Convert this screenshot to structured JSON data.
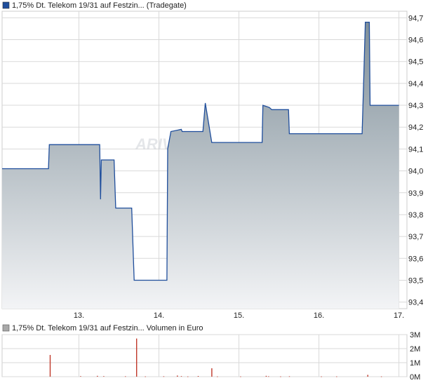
{
  "legend": {
    "price_label": "1,75% Dt. Telekom 19/31 auf Festzin... (Tradegate)",
    "volume_label": "1,75% Dt. Telekom 19/31 auf Festzin... Volumen in Euro"
  },
  "watermark": "ARIVA",
  "colors": {
    "line": "#1f4e9c",
    "fill_top": "#7f8f99",
    "fill_bottom": "#f3f4f6",
    "grid": "#d9d9d9",
    "volume_bar": "#c0392b",
    "legend_swatch_price": "#1f4e9c",
    "legend_swatch_volume": "#a9a9a9"
  },
  "chart_data": [
    {
      "type": "area",
      "xlabel": "",
      "ylabel": "",
      "x_ticks": [
        "13.",
        "14.",
        "15.",
        "16.",
        "17."
      ],
      "x_tick_values": [
        13,
        14,
        15,
        16,
        17
      ],
      "xlim": [
        12.04,
        17.1
      ],
      "ylim": [
        93.37,
        94.73
      ],
      "y_ticks": [
        "93,4",
        "93,5",
        "93,6",
        "93,7",
        "93,8",
        "93,9",
        "94,0",
        "94,1",
        "94,2",
        "94,3",
        "94,4",
        "94,5",
        "94,6",
        "94,7"
      ],
      "y_tick_values": [
        93.4,
        93.5,
        93.6,
        93.7,
        93.8,
        93.9,
        94.0,
        94.1,
        94.2,
        94.3,
        94.4,
        94.5,
        94.6,
        94.7
      ],
      "grid": true,
      "y_axis_position": "right",
      "series": [
        {
          "points": [
            [
              12.04,
              94.01
            ],
            [
              12.62,
              94.01
            ],
            [
              12.63,
              94.12
            ],
            [
              13.26,
              94.12
            ],
            [
              13.27,
              93.87
            ],
            [
              13.28,
              94.05
            ],
            [
              13.44,
              94.05
            ],
            [
              13.46,
              93.83
            ],
            [
              13.66,
              93.83
            ],
            [
              13.69,
              93.5
            ],
            [
              14.1,
              93.5
            ],
            [
              14.11,
              94.1
            ],
            [
              14.15,
              94.18
            ],
            [
              14.28,
              94.19
            ],
            [
              14.29,
              94.18
            ],
            [
              14.55,
              94.18
            ],
            [
              14.58,
              94.31
            ],
            [
              14.62,
              94.22
            ],
            [
              14.66,
              94.13
            ],
            [
              15.29,
              94.13
            ],
            [
              15.3,
              94.3
            ],
            [
              15.38,
              94.29
            ],
            [
              15.41,
              94.28
            ],
            [
              15.62,
              94.28
            ],
            [
              15.63,
              94.17
            ],
            [
              16.54,
              94.17
            ],
            [
              16.56,
              94.42
            ],
            [
              16.58,
              94.68
            ],
            [
              16.63,
              94.68
            ],
            [
              16.64,
              94.3
            ],
            [
              17.0,
              94.3
            ]
          ]
        }
      ]
    },
    {
      "type": "bar",
      "xlabel": "",
      "ylabel": "",
      "xlim": [
        12.04,
        17.1
      ],
      "ylim": [
        0,
        3000000
      ],
      "y_ticks": [
        "3M",
        "2M",
        "1M",
        "0M"
      ],
      "y_tick_values": [
        3000000,
        2000000,
        1000000,
        0
      ],
      "grid": true,
      "y_axis_position": "right",
      "bars": [
        [
          12.64,
          1550000
        ],
        [
          13.02,
          40000
        ],
        [
          13.23,
          60000
        ],
        [
          13.31,
          40000
        ],
        [
          13.58,
          30000
        ],
        [
          13.72,
          2720000
        ],
        [
          13.83,
          20000
        ],
        [
          14.06,
          30000
        ],
        [
          14.23,
          80000
        ],
        [
          14.28,
          40000
        ],
        [
          14.36,
          20000
        ],
        [
          14.49,
          50000
        ],
        [
          14.66,
          600000
        ],
        [
          14.73,
          20000
        ],
        [
          15.02,
          20000
        ],
        [
          15.34,
          60000
        ],
        [
          15.37,
          30000
        ],
        [
          15.52,
          20000
        ],
        [
          15.63,
          30000
        ],
        [
          16.03,
          20000
        ],
        [
          16.22,
          20000
        ],
        [
          16.61,
          130000
        ],
        [
          16.78,
          20000
        ]
      ]
    }
  ]
}
